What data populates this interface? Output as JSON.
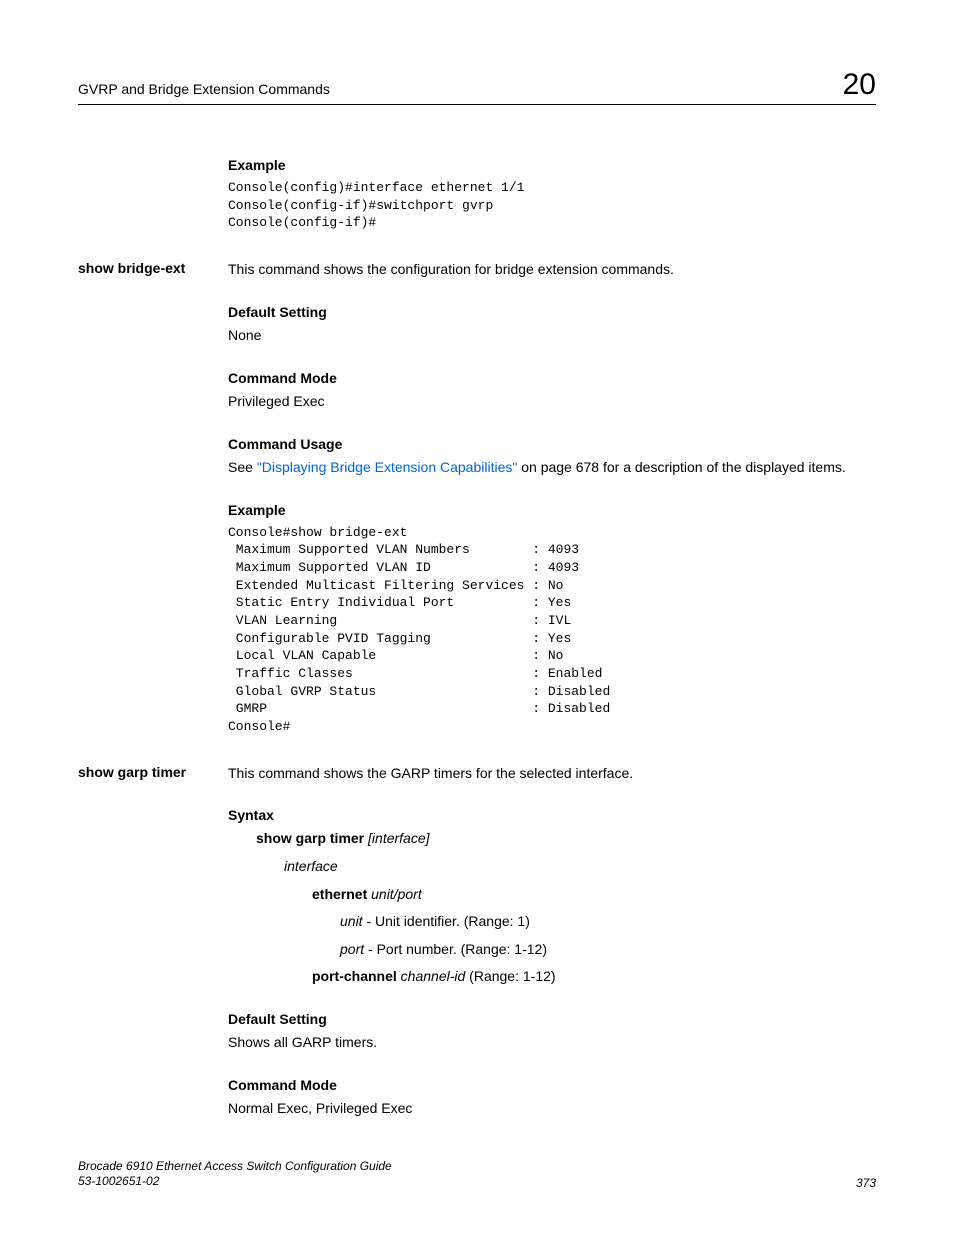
{
  "header": {
    "title": "GVRP and Bridge Extension Commands",
    "chapter": "20"
  },
  "sections": {
    "example1": {
      "heading": "Example",
      "code": "Console(config)#interface ethernet 1/1\nConsole(config-if)#switchport gvrp\nConsole(config-if)#"
    },
    "showBridgeExt": {
      "command": "show bridge-ext",
      "description": "This command shows the configuration for bridge extension commands.",
      "defaultSetting": {
        "heading": "Default Setting",
        "value": "None"
      },
      "commandMode": {
        "heading": "Command Mode",
        "value": "Privileged Exec"
      },
      "commandUsage": {
        "heading": "Command Usage",
        "prefix": "See ",
        "link": "\"Displaying Bridge Extension Capabilities\"",
        "suffix": " on page 678 for a description of the displayed items."
      },
      "example": {
        "heading": "Example",
        "code": "Console#show bridge-ext\n Maximum Supported VLAN Numbers        : 4093\n Maximum Supported VLAN ID             : 4093\n Extended Multicast Filtering Services : No\n Static Entry Individual Port          : Yes\n VLAN Learning                         : IVL\n Configurable PVID Tagging             : Yes\n Local VLAN Capable                    : No\n Traffic Classes                       : Enabled\n Global GVRP Status                    : Disabled\n GMRP                                  : Disabled\nConsole#"
      }
    },
    "showGarpTimer": {
      "command": "show garp timer",
      "description": "This command shows the GARP timers for the selected interface.",
      "syntax": {
        "heading": "Syntax",
        "line1_bold": "show garp timer",
        "line1_rest": " [interface]",
        "line2": "interface",
        "ethernet_bold": "ethernet",
        "ethernet_rest": " unit/port",
        "unit_label": "unit",
        "unit_desc": " - Unit identifier. (Range: 1)",
        "port_label": "port",
        "port_desc": " - Port number. (Range: 1-12)",
        "portchannel_bold": "port-channel",
        "portchannel_italic": " channel-id",
        "portchannel_rest": " (Range: 1-12)"
      },
      "defaultSetting": {
        "heading": "Default Setting",
        "value": "Shows all GARP timers."
      },
      "commandMode": {
        "heading": "Command Mode",
        "value": "Normal Exec, Privileged Exec"
      }
    }
  },
  "footer": {
    "line1": "Brocade 6910 Ethernet Access Switch Configuration Guide",
    "line2": "53-1002651-02",
    "page": "373"
  }
}
